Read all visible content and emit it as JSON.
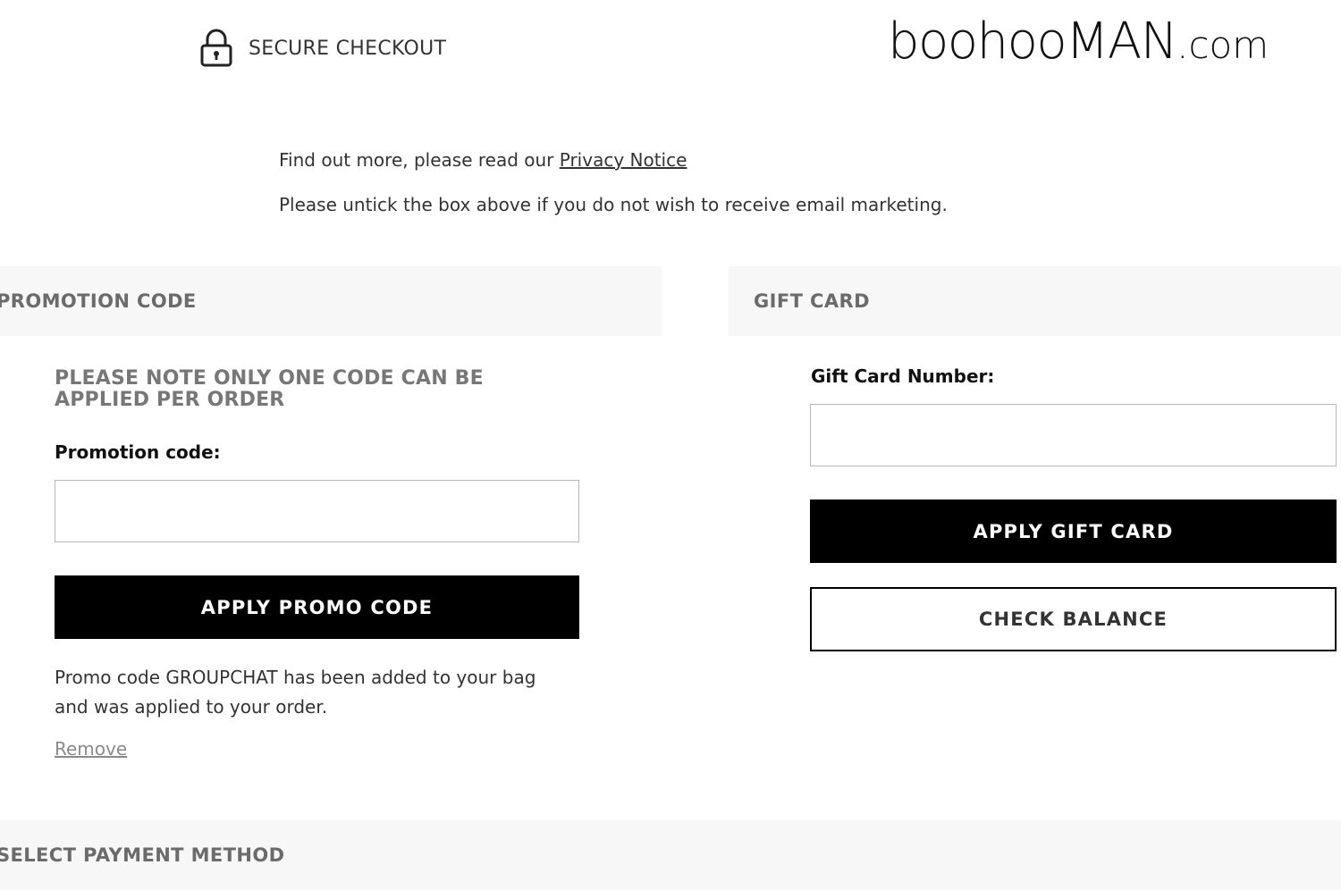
{
  "header": {
    "secure_label": "SECURE CHECKOUT",
    "logo_text": "boohooMAN",
    "logo_suffix": ".com",
    "lock_icon": "lock-icon"
  },
  "marketing": {
    "line1_prefix": "Find out more, please read our ",
    "privacy_link": "Privacy Notice",
    "line2": "Please untick the box above if you do not wish to receive email marketing."
  },
  "promotion": {
    "section_title": "PROMOTION CODE",
    "note": "PLEASE NOTE ONLY ONE CODE CAN BE APPLIED PER ORDER",
    "field_label": "Promotion code:",
    "field_value": "",
    "apply_label": "APPLY PROMO CODE",
    "applied_message": "Promo code GROUPCHAT has been added to your bag and was applied to your order.",
    "remove_label": "Remove"
  },
  "gift_card": {
    "section_title": "GIFT CARD",
    "field_label": "Gift Card Number:",
    "field_value": "",
    "apply_label": "APPLY GIFT CARD",
    "check_label": "CHECK BALANCE"
  },
  "payment": {
    "section_title": "SELECT PAYMENT METHOD"
  },
  "colors": {
    "button_bg": "#000000",
    "section_bar_bg": "#f7f7f7",
    "section_title_text": "#6b6b6b"
  }
}
